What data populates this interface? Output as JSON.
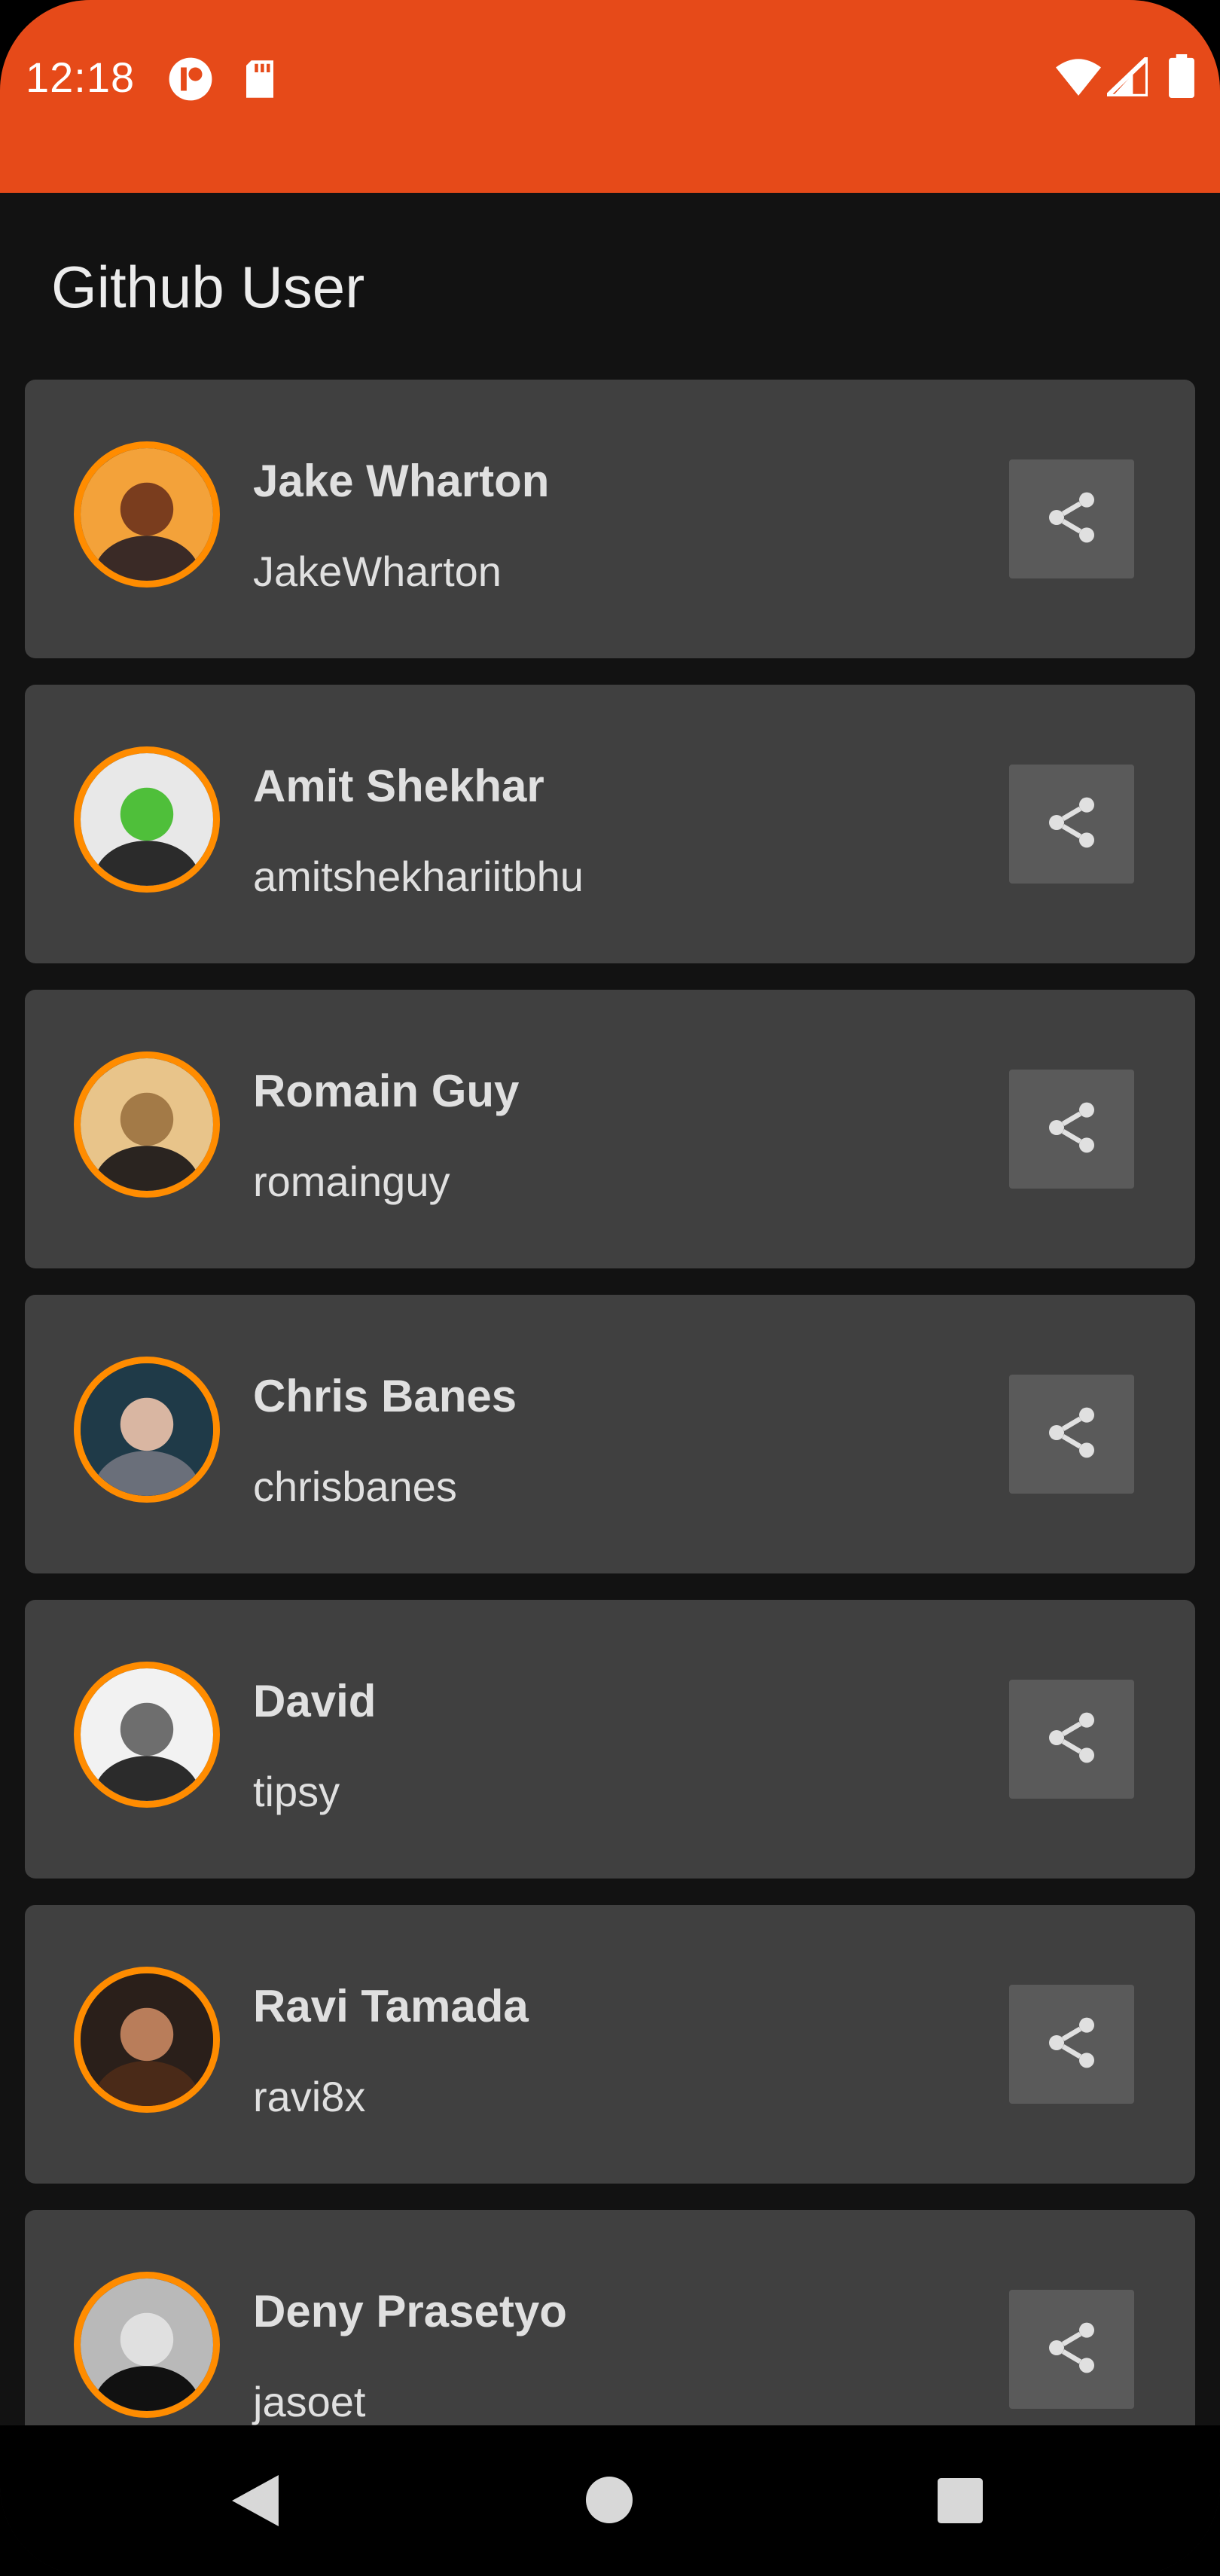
{
  "status_bar": {
    "time": "12:18",
    "bg_color": "#E64A19",
    "icons": [
      "notification-app-icon",
      "sd-card-icon",
      "wifi-icon",
      "cell-signal-icon",
      "battery-icon"
    ]
  },
  "app": {
    "title": "Github User"
  },
  "users": [
    {
      "name": "Jake Wharton",
      "login": "JakeWharton",
      "avatar_colors": [
        "#F3A23A",
        "#7A3D1E",
        "#3A2A26"
      ]
    },
    {
      "name": "Amit Shekhar",
      "login": "amitshekhariitbhu",
      "avatar_colors": [
        "#E8E8E8",
        "#4FBF3A",
        "#2B2B2B"
      ]
    },
    {
      "name": "Romain Guy",
      "login": "romainguy",
      "avatar_colors": [
        "#E8C48A",
        "#A37A47",
        "#2A2420"
      ]
    },
    {
      "name": "Chris Banes",
      "login": "chrisbanes",
      "avatar_colors": [
        "#1F3A48",
        "#D9B6A2",
        "#6A6F7A"
      ]
    },
    {
      "name": "David",
      "login": "tipsy",
      "avatar_colors": [
        "#F2F2F2",
        "#6E6E6E",
        "#2B2B2B"
      ]
    },
    {
      "name": "Ravi Tamada",
      "login": "ravi8x",
      "avatar_colors": [
        "#2A1F1A",
        "#B97D5A",
        "#4A2A18"
      ]
    },
    {
      "name": "Deny Prasetyo",
      "login": "jasoet",
      "avatar_colors": [
        "#B9B9B9",
        "#E0E0E0",
        "#111111"
      ]
    }
  ],
  "share_icon": "share-icon",
  "colors": {
    "accent_ring": "#FF8C00",
    "card_bg": "#404040",
    "share_bg": "#5A5A5A",
    "background": "#121212"
  },
  "nav_bar": {
    "buttons": [
      "back-icon",
      "home-icon",
      "recents-icon"
    ]
  }
}
